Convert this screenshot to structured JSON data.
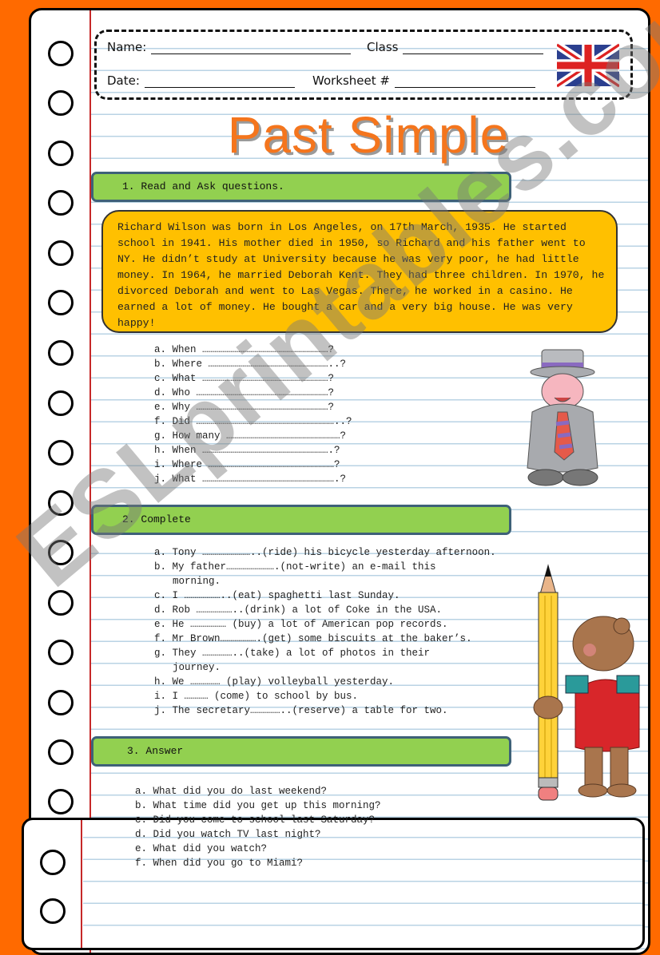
{
  "header": {
    "name_label": "Name:",
    "class_label": "Class",
    "date_label": "Date:",
    "worksheet_label": "Worksheet #",
    "flag_icon": "union-jack-flag"
  },
  "title": "Past Simple",
  "section1": {
    "heading": "1. Read and Ask questions.",
    "reading_text": "Richard Wilson was born in Los Angeles, on 17th March, 1935. He started school in 1941. His mother died in 1950, so Richard and his father went to NY. He didn’t study at University because he was very poor, he had little money. In 1964, he married Deborah Kent. They had three children. In 1970, he divorced Deborah and went to Las Vegas. There, he worked in a casino. He earned a lot of money. He bought a car and a very big house. He was very happy!",
    "questions": [
      "a. When ………………………………………………………?",
      "b. Where ……………………………………………………..?",
      "c. What ………………………………………………………?",
      "d. Who …………………………………………………………?",
      "e. Why …………………………………………………………?",
      "f. Did ……………………………………………………………..?",
      "g. How many …………………………………………………?",
      "h. When ……………………………………………………….?",
      "i. Where ………………………………………………………?",
      "j. What ………………………………………………………….?"
    ]
  },
  "section2": {
    "heading": "2. Complete",
    "items": [
      [
        "a. Tony ……………………..(ride) his bicycle yesterday afternoon."
      ],
      [
        "b. My father…………………….(not-write) an e-mail this",
        "morning."
      ],
      [
        "c. I ………………..(eat) spaghetti last Sunday."
      ],
      [
        "d. Rob ………………..(drink) a lot of Coke in the USA."
      ],
      [
        "e. He ……………… (buy) a lot of American pop records."
      ],
      [
        "f. Mr Brown……………….(get) some biscuits at the baker’s."
      ],
      [
        "g. They ……………..(take) a lot of photos in their",
        "journey."
      ],
      [
        "h. We …………… (play) volleyball yesterday."
      ],
      [
        "i. I ………… (come) to school by bus."
      ],
      [
        "j. The secretary……………..(reserve) a table for two."
      ]
    ]
  },
  "section3": {
    "heading": "3. Answer",
    "questions": [
      "a. What did you do last weekend?",
      "b. What time did you get up this morning?",
      "c. Did you come to school last Saturday?",
      "d. Did you watch TV last night?",
      "e. What did you watch?",
      "f. When did you go to Miami?"
    ]
  },
  "watermark": "ESLprintables.com",
  "colors": {
    "background": "#ff6a00",
    "title": "#f4751d",
    "section_bar": "#92d050",
    "section_border": "#3e6178",
    "reading_box": "#ffc000",
    "margin_line": "#c62828"
  }
}
